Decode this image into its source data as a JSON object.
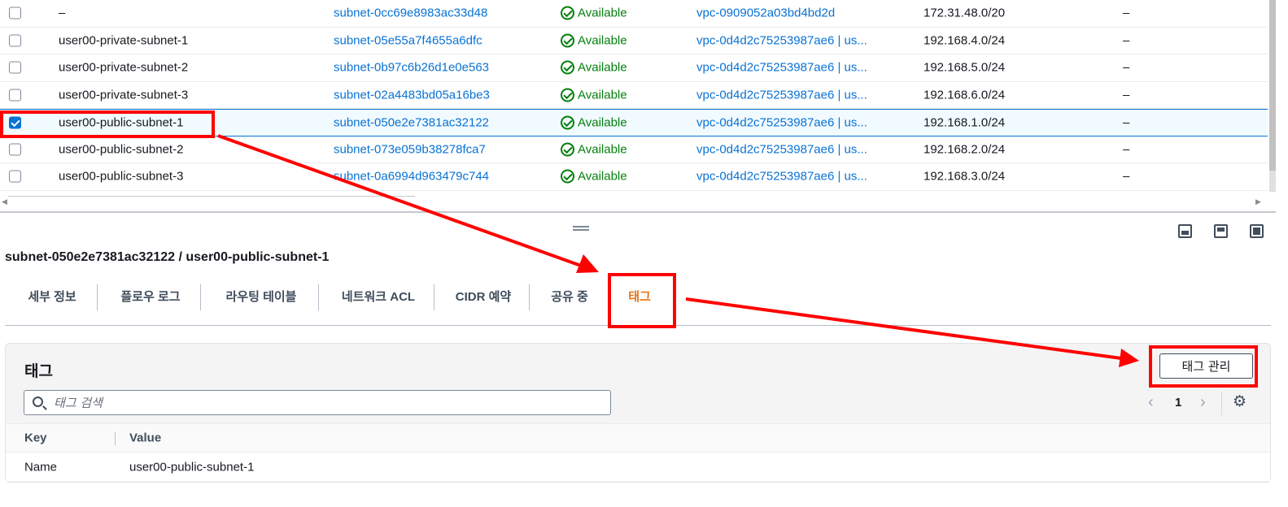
{
  "subnets": [
    {
      "name": "–",
      "id": "subnet-0cc69e8983ac33d48",
      "state": "Available",
      "vpc": "vpc-0909052a03bd4bd2d",
      "cidr": "172.31.48.0/20",
      "ipv6": "–",
      "checked": false
    },
    {
      "name": "user00-private-subnet-1",
      "id": "subnet-05e55a7f4655a6dfc",
      "state": "Available",
      "vpc": "vpc-0d4d2c75253987ae6 | us...",
      "cidr": "192.168.4.0/24",
      "ipv6": "–",
      "checked": false
    },
    {
      "name": "user00-private-subnet-2",
      "id": "subnet-0b97c6b26d1e0e563",
      "state": "Available",
      "vpc": "vpc-0d4d2c75253987ae6 | us...",
      "cidr": "192.168.5.0/24",
      "ipv6": "–",
      "checked": false
    },
    {
      "name": "user00-private-subnet-3",
      "id": "subnet-02a4483bd05a16be3",
      "state": "Available",
      "vpc": "vpc-0d4d2c75253987ae6 | us...",
      "cidr": "192.168.6.0/24",
      "ipv6": "–",
      "checked": false
    },
    {
      "name": "user00-public-subnet-1",
      "id": "subnet-050e2e7381ac32122",
      "state": "Available",
      "vpc": "vpc-0d4d2c75253987ae6 | us...",
      "cidr": "192.168.1.0/24",
      "ipv6": "–",
      "checked": true
    },
    {
      "name": "user00-public-subnet-2",
      "id": "subnet-073e059b38278fca7",
      "state": "Available",
      "vpc": "vpc-0d4d2c75253987ae6 | us...",
      "cidr": "192.168.2.0/24",
      "ipv6": "–",
      "checked": false
    },
    {
      "name": "user00-public-subnet-3",
      "id": "subnet-0a6994d963479c744",
      "state": "Available",
      "vpc": "vpc-0d4d2c75253987ae6 | us...",
      "cidr": "192.168.3.0/24",
      "ipv6": "–",
      "checked": false
    }
  ],
  "panel": {
    "title": "subnet-050e2e7381ac32122 / user00-public-subnet-1",
    "tabs": [
      "세부 정보",
      "플로우 로그",
      "라우팅 테이블",
      "네트워크 ACL",
      "CIDR 예약",
      "공유 중",
      "태그"
    ],
    "active_tab": "태그"
  },
  "tags": {
    "title": "태그",
    "manage_label": "태그 관리",
    "search_placeholder": "태그 검색",
    "page": "1",
    "columns": [
      "Key",
      "Value"
    ],
    "rows": [
      {
        "key": "Name",
        "value": "user00-public-subnet-1"
      }
    ]
  },
  "colors": {
    "link": "#0972d3",
    "success": "#037f0c",
    "active_tab": "#ec7211",
    "annotation": "#ff0000"
  },
  "icons": [
    "checkbox-icon",
    "status-available-icon",
    "search-icon",
    "chevron-left-icon",
    "chevron-right-icon",
    "settings-icon",
    "drag-handle-icon",
    "panel-bottom-icon",
    "panel-side-icon",
    "panel-full-icon"
  ]
}
